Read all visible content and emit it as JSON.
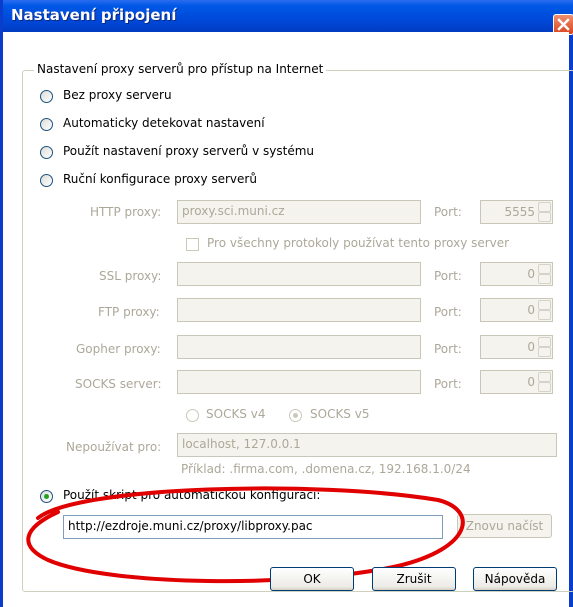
{
  "window": {
    "title": "Nastavení připojení"
  },
  "group": {
    "legend": "Nastavení proxy serverů pro přístup na Internet"
  },
  "options": [
    {
      "label": "Bez proxy serveru",
      "checked": false
    },
    {
      "label": "Automaticky detekovat nastavení",
      "checked": false
    },
    {
      "label": "Použít nastavení proxy serverů v systému",
      "checked": false
    },
    {
      "label": "Ruční konfigurace proxy serverů",
      "checked": false
    }
  ],
  "manual": {
    "http_label": "HTTP proxy:",
    "http_value": "proxy.sci.muni.cz",
    "http_port": "5555",
    "share_label": "Pro všechny protokoly používat tento proxy server",
    "ssl_label": "SSL proxy:",
    "ssl_port": "0",
    "ftp_label": "FTP proxy:",
    "ftp_port": "0",
    "gopher_label": "Gopher proxy:",
    "gopher_port": "0",
    "socks_label": "SOCKS server:",
    "socks_port": "0",
    "port_label": "Port:",
    "socks_v4": "SOCKS v4",
    "socks_v5": "SOCKS v5",
    "no_proxy_label": "Nepoužívat pro:",
    "no_proxy_value": "localhost, 127.0.0.1",
    "example": "Příklad: .firma.com, .domena.cz, 192.168.1.0/24"
  },
  "auto": {
    "label": "Použít skript pro automatickou konfiguraci:",
    "url": "http://ezdroje.muni.cz/proxy/libproxy.pac",
    "reload": "Znovu načíst"
  },
  "buttons": {
    "ok": "OK",
    "cancel": "Zrušit",
    "help": "Nápověda"
  },
  "colors": {
    "titlebar": "#0058e6",
    "annotation": "#e00000",
    "radio_checked": "#21a121"
  }
}
